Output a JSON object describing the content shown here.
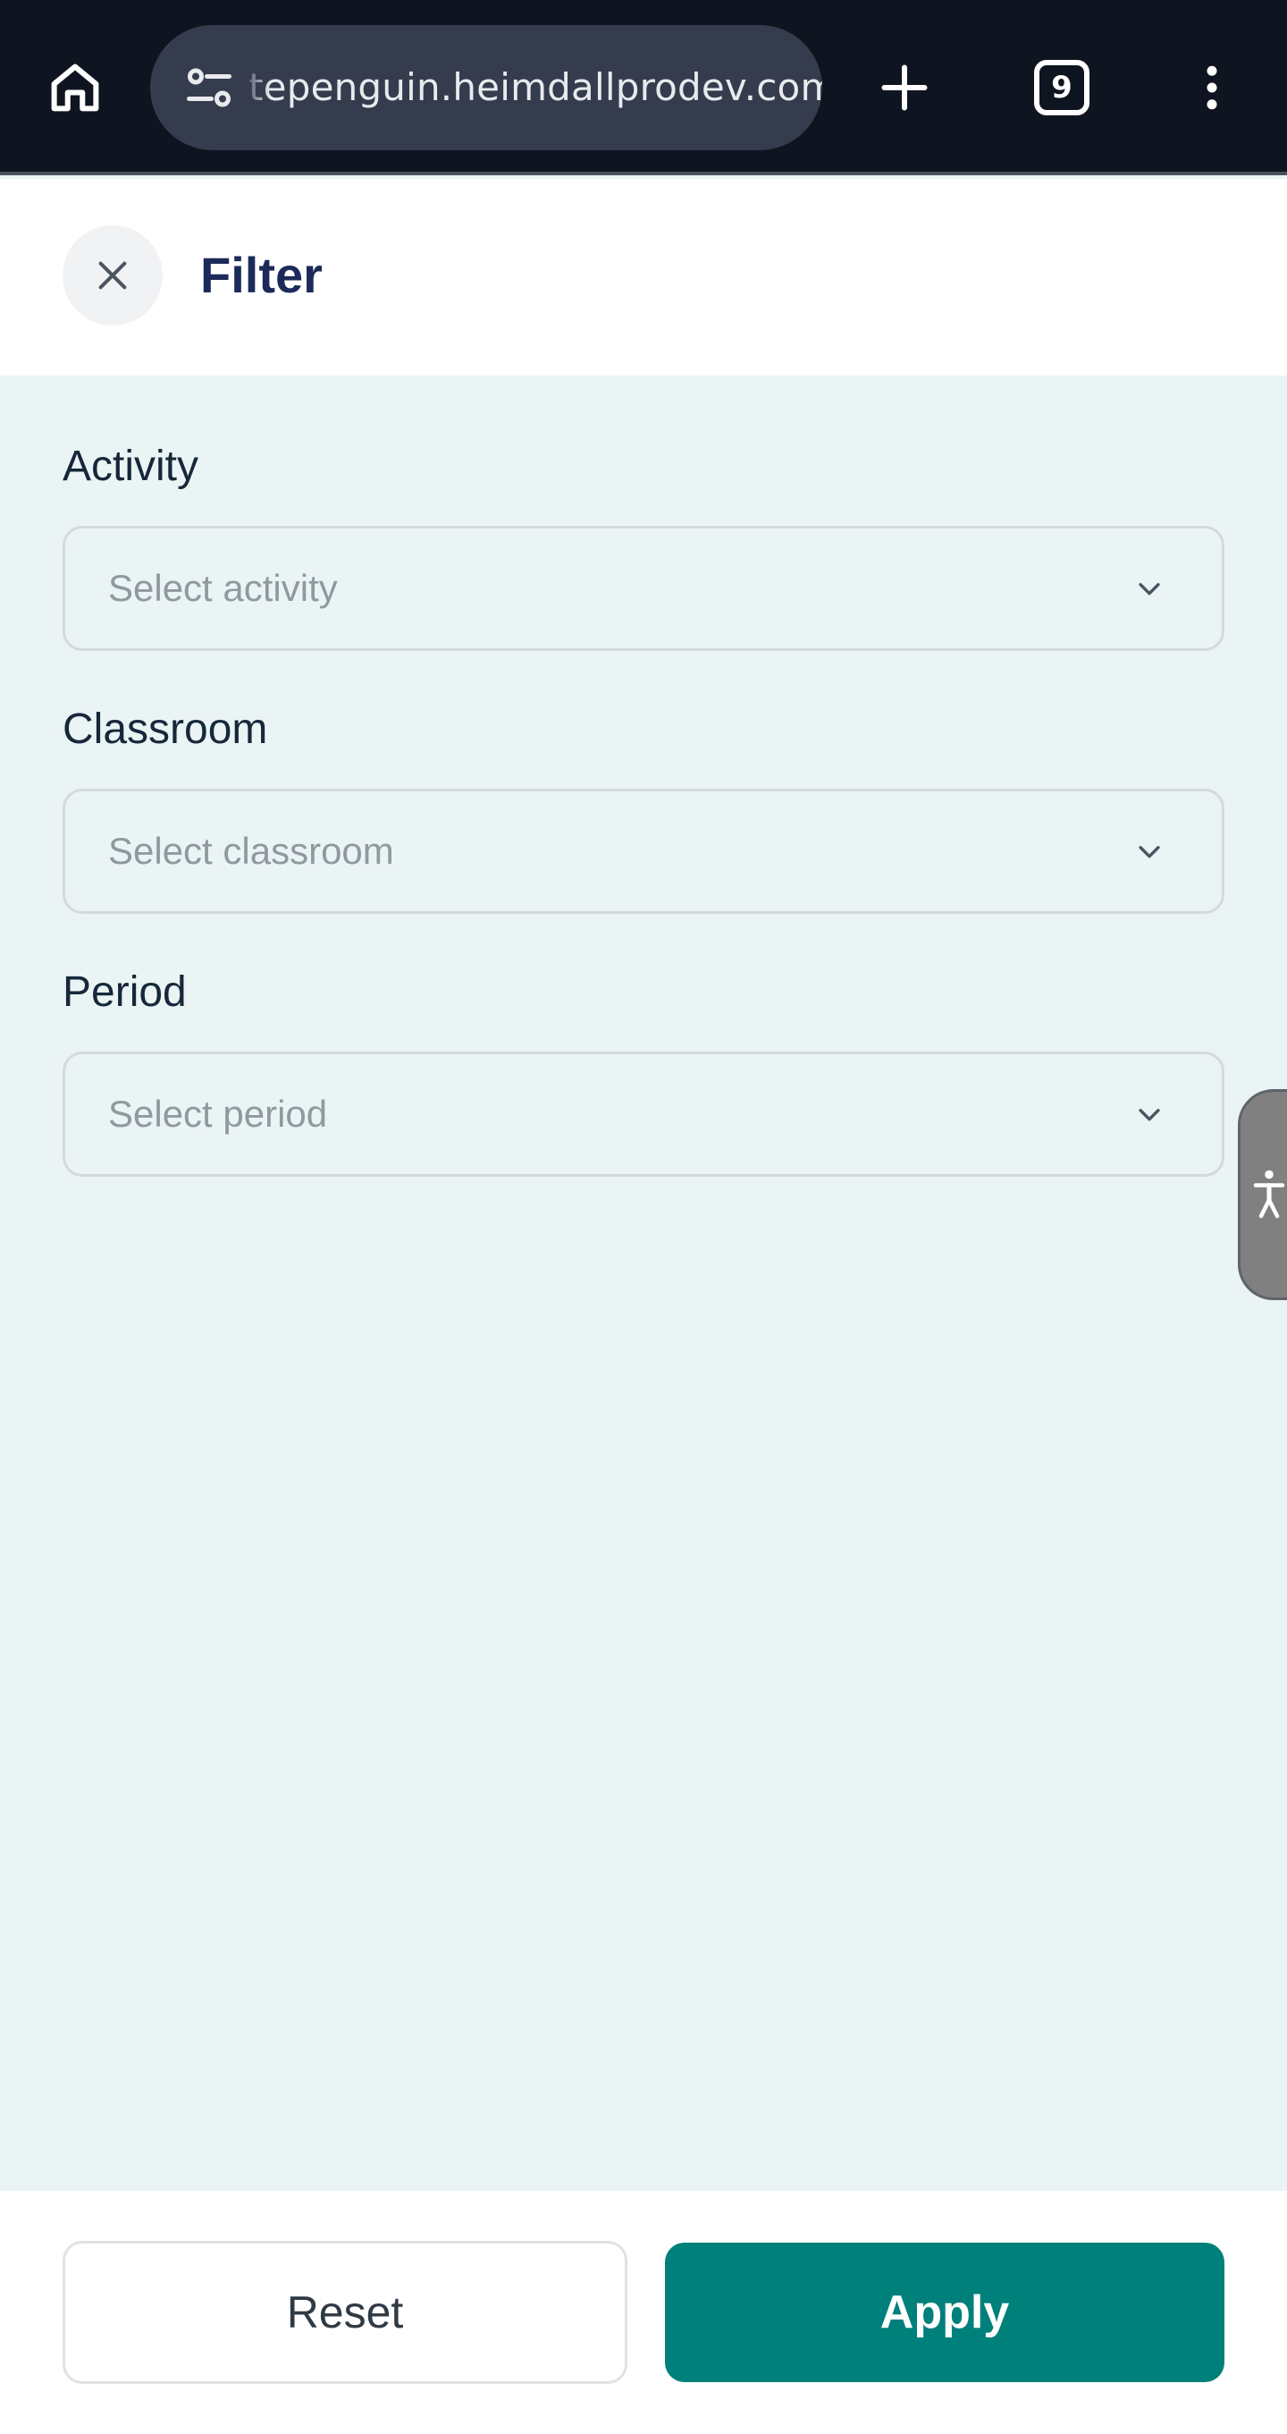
{
  "browser": {
    "url_text": "tepenguin.heimdallprodev.com",
    "tab_count": "9",
    "icons": {
      "home": "home-icon",
      "site_settings": "tune-icon",
      "new_tab": "plus-icon",
      "tabs": "tab-switcher-icon",
      "menu": "more-vert-icon"
    }
  },
  "header": {
    "title": "Filter",
    "close_icon": "close-icon"
  },
  "form": {
    "activity": {
      "label": "Activity",
      "placeholder": "Select activity"
    },
    "classroom": {
      "label": "Classroom",
      "placeholder": "Select classroom"
    },
    "period": {
      "label": "Period",
      "placeholder": "Select period"
    }
  },
  "footer": {
    "reset_label": "Reset",
    "apply_label": "Apply"
  },
  "colors": {
    "accent": "#00807b",
    "title": "#1b2a5a",
    "background": "#ebf4f5",
    "browser_bar": "#0f1520"
  }
}
